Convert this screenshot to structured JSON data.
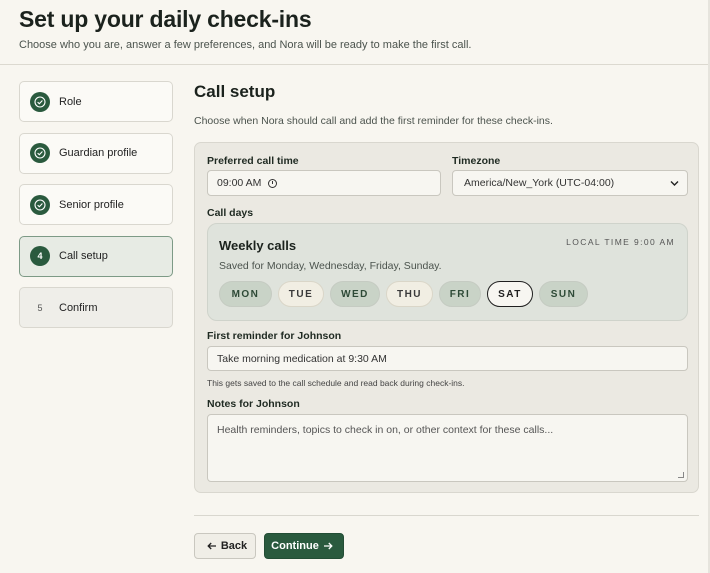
{
  "header": {
    "title": "Set up your daily check-ins",
    "subtitle": "Choose who you are, answer a few preferences, and Nora will be ready to make the first call."
  },
  "steps": [
    {
      "badge": "",
      "label": "Role",
      "state": "done"
    },
    {
      "badge": "",
      "label": "Guardian profile",
      "state": "done"
    },
    {
      "badge": "",
      "label": "Senior profile",
      "state": "done"
    },
    {
      "badge": "4",
      "label": "Call setup",
      "state": "active"
    },
    {
      "badge": "5",
      "label": "Confirm",
      "state": "pending"
    }
  ],
  "section": {
    "title": "Call setup",
    "description": "Choose when Nora should call and add the first reminder for these check-ins."
  },
  "form": {
    "call_time_label": "Preferred call time",
    "call_time_value": "09:00 AM",
    "timezone_label": "Timezone",
    "timezone_value": "America/New_York (UTC-04:00)",
    "call_days_label": "Call days",
    "weekly": {
      "title": "Weekly calls",
      "saved": "Saved for Monday, Wednesday, Friday, Sunday.",
      "local_time": "LOCAL TIME 9:00 AM",
      "days": [
        {
          "label": "MON",
          "state": "on"
        },
        {
          "label": "TUE",
          "state": "off"
        },
        {
          "label": "WED",
          "state": "on"
        },
        {
          "label": "THU",
          "state": "off"
        },
        {
          "label": "FRI",
          "state": "on"
        },
        {
          "label": "SAT",
          "state": "focus"
        },
        {
          "label": "SUN",
          "state": "on"
        }
      ]
    },
    "reminder_label": "First reminder for Johnson",
    "reminder_value": "Take morning medication at 9:30 AM",
    "reminder_help": "This gets saved to the call schedule and read back during check-ins.",
    "notes_label": "Notes for Johnson",
    "notes_placeholder": "Health reminders, topics to check in on, or other context for these calls..."
  },
  "actions": {
    "back_label": "Back",
    "continue_label": "Continue"
  },
  "colors": {
    "accent": "#2a5a3e",
    "background": "#f8f6f0",
    "panel": "#ebe9e2"
  },
  "icons": {
    "step_done": "check-circle-icon",
    "time": "clock-icon",
    "select": "chevron-down-icon",
    "back": "arrow-left-icon",
    "continue": "arrow-right-icon"
  }
}
